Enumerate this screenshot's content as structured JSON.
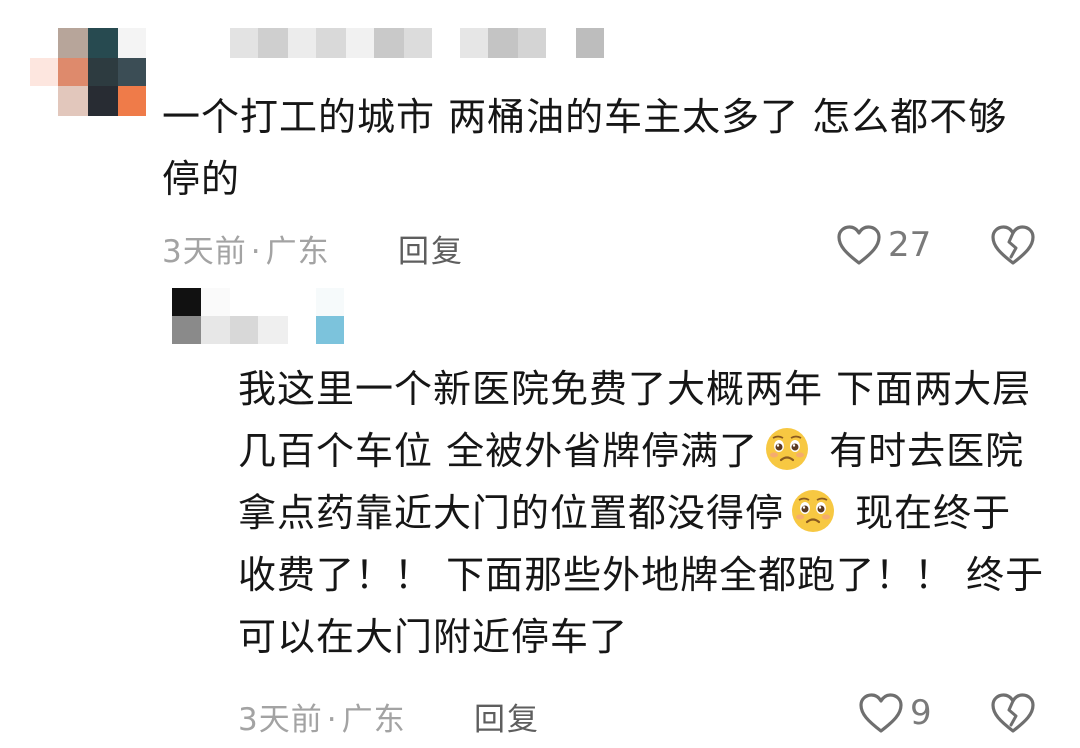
{
  "comments": [
    {
      "text": "一个打工的城市 两桶油的车主太多了 怎么都不够停的",
      "time": "3天前",
      "separator": "·",
      "location": "广东",
      "reply_label": "回复",
      "like_count": "27"
    }
  ],
  "reply": {
    "text_before_emoji_1": "我这里一个新医院免费了大概两年 下面两大层几百个车位 全被外省牌停满了",
    "text_before_emoji_2": " 有时去医院拿点药靠近大门的位置都没得停",
    "text_after": " 现在终于收费了！！ 下面那些外地牌全都跑了！！ 终于可以在大门附近停车了",
    "time": "3天前",
    "separator": "·",
    "location": "广东",
    "reply_label": "回复",
    "like_count": "9"
  },
  "icons": {
    "like": "heart-outline-icon",
    "dislike": "broken-heart-icon",
    "emoji": "pleading-face-emoji"
  },
  "colors": {
    "text": "#161616",
    "meta": "#a3a3a3",
    "reply": "#5e5e5e",
    "icon": "#6f6f6f",
    "emoji_face": "#f7c842"
  }
}
